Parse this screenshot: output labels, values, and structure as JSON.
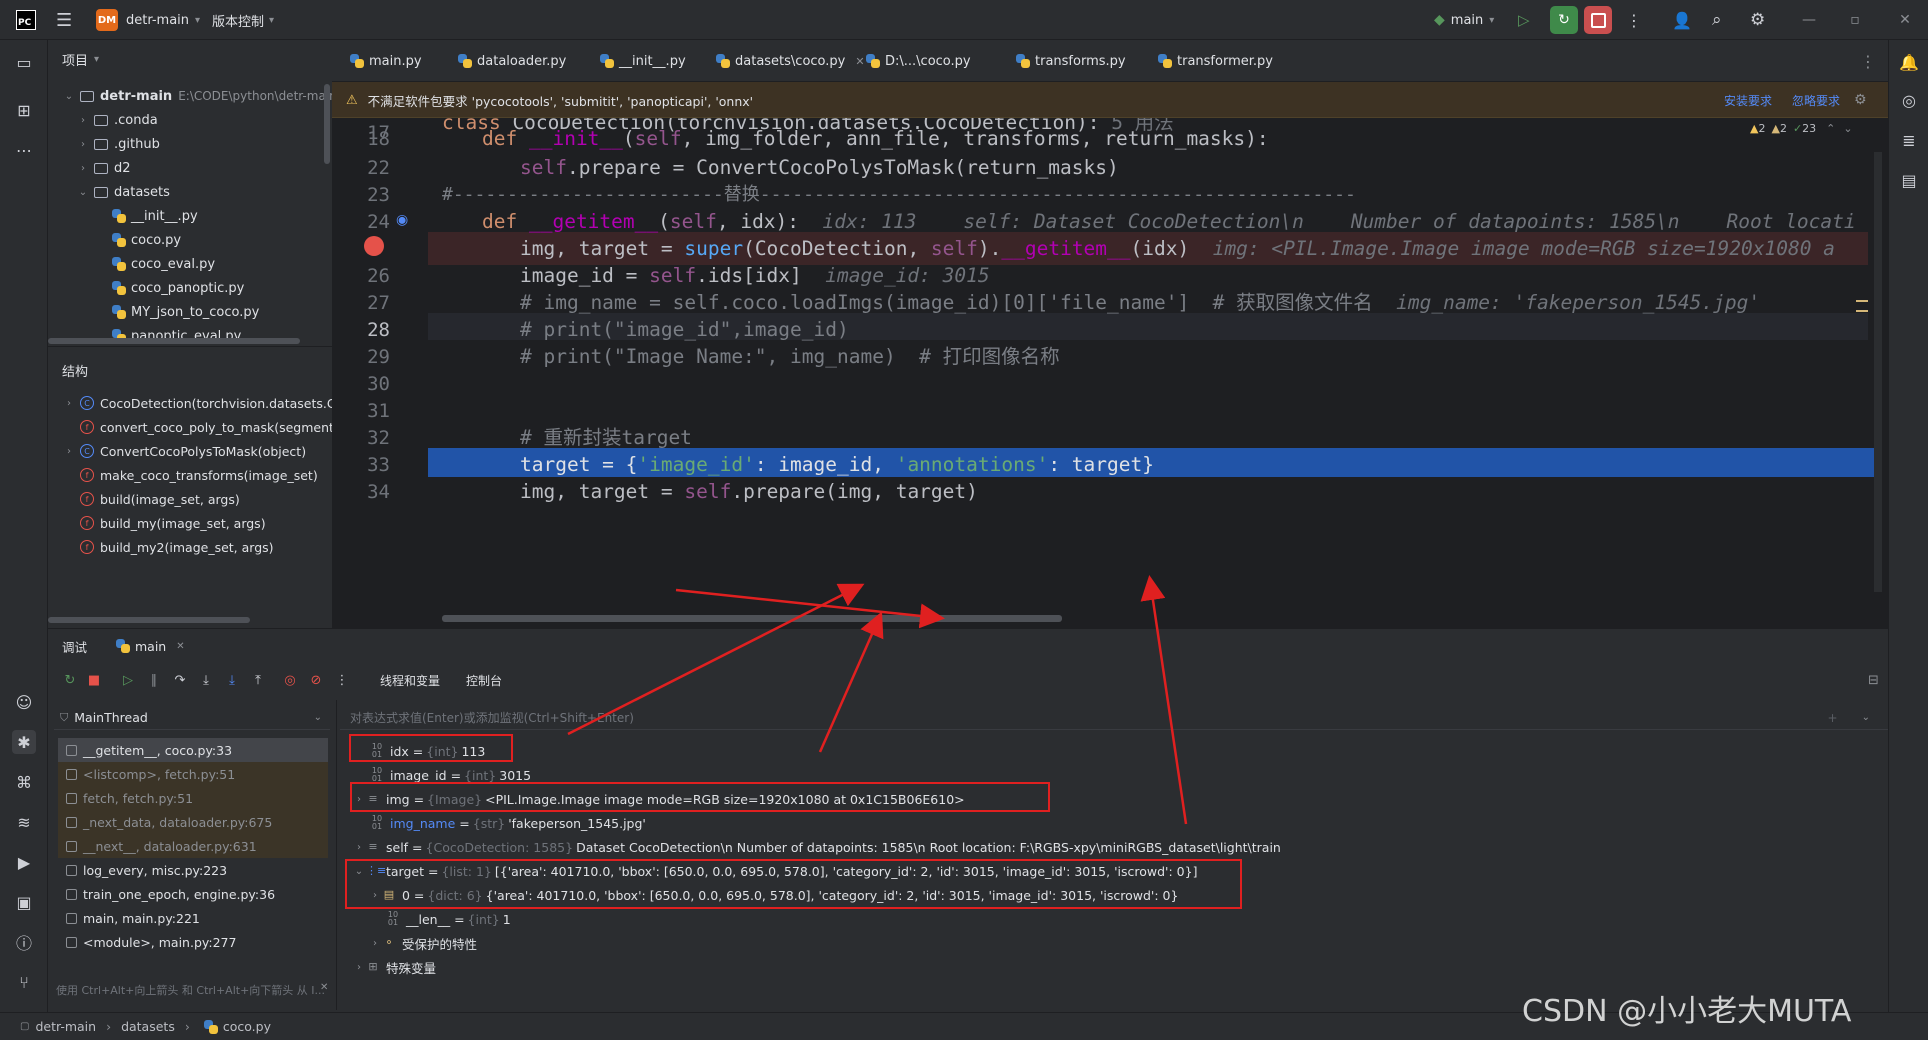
{
  "topbar": {
    "project_badge": "DM",
    "project_name": "detr-main",
    "vcs_label": "版本控制",
    "branch": "main"
  },
  "project_panel": {
    "title": "项目",
    "root_name": "detr-main",
    "root_path": "E:\\CODE\\python\\detr-main",
    "items": [
      ".conda",
      ".github",
      "d2",
      "datasets",
      "__init__.py",
      "coco.py",
      "coco_eval.py",
      "coco_panoptic.py",
      "MY_json_to_coco.py",
      "panoptic_eval.py"
    ]
  },
  "structure_panel": {
    "title": "结构",
    "items": [
      "CocoDetection(torchvision.datasets.Coco",
      "convert_coco_poly_to_mask(segmentatic",
      "ConvertCocoPolysToMask(object)",
      "make_coco_transforms(image_set)",
      "build(image_set, args)",
      "build_my(image_set, args)",
      "build_my2(image_set, args)"
    ]
  },
  "tabs": [
    "main.py",
    "dataloader.py",
    "__init__.py",
    "datasets\\coco.py",
    "D:\\...\\coco.py",
    "transforms.py",
    "transformer.py"
  ],
  "banner": {
    "message": "不满足软件包要求 'pycocotools', 'submitit', 'panopticapi', 'onnx'",
    "install": "安装要求",
    "ignore": "忽略要求"
  },
  "inspections": {
    "warn": "2",
    "weak": "2",
    "ok": "23"
  },
  "editor": {
    "line_numbers": [
      "17",
      "18",
      "22",
      "23",
      "24",
      "25",
      "26",
      "27",
      "28",
      "29",
      "30",
      "31",
      "32",
      "33",
      "34"
    ],
    "l17_usages": "5 用法",
    "l23_text": "#-------------------------替换-------------------------------------------------------",
    "l24_hint": "idx: 113    self: Dataset CocoDetection\\n    Number of datapoints: 1585\\n    Root locati",
    "l25_hint": "img: <PIL.Image.Image image mode=RGB size=1920x1080 a",
    "l26_hint": "image_id: 3015",
    "l27_comment": "# img_name = self.coco.loadImgs(image_id)[0]['file_name']  # 获取图像文件名",
    "l27_hint": "img_name: 'fakeperson_1545.jpg'",
    "l28_comment": "# print(\"image_id\",image_id)",
    "l29_comment": "# print(\"Image Name:\", img_name)  # 打印图像名称",
    "l32_comment": "# 重新封装target"
  },
  "debug": {
    "tab_debug": "调试",
    "tab_main": "main",
    "tab_threads": "线程和变量",
    "tab_console": "控制台",
    "thread": "MainThread",
    "eval_placeholder": "对表达式求值(Enter)或添加监视(Ctrl+Shift+Enter)",
    "frames": [
      "__getitem__, coco.py:33",
      "<listcomp>, fetch.py:51",
      "fetch, fetch.py:51",
      "_next_data, dataloader.py:675",
      "__next__, dataloader.py:631",
      "log_every, misc.py:223",
      "train_one_epoch, engine.py:36",
      "main, main.py:221",
      "<module>, main.py:277"
    ],
    "hint_bottom": "使用 Ctrl+Alt+向上箭头 和 Ctrl+Alt+向下箭头 从 I...",
    "vars": [
      {
        "name": "idx",
        "type": "{int}",
        "value": "113"
      },
      {
        "name": "image_id",
        "type": "{int}",
        "value": "3015"
      },
      {
        "name": "img",
        "type": "{Image}",
        "value": "<PIL.Image.Image image mode=RGB size=1920x1080 at 0x1C15B06E610>"
      },
      {
        "name": "img_name",
        "type": "{str}",
        "value": "'fakeperson_1545.jpg'"
      },
      {
        "name": "self",
        "type": "{CocoDetection: 1585}",
        "value": "Dataset CocoDetection\\n    Number of datapoints: 1585\\n    Root location: F:\\RGBS-xpy\\miniRGBS_dataset\\light\\train"
      },
      {
        "name": "target",
        "type": "{list: 1}",
        "value": "[{'area': 401710.0, 'bbox': [650.0, 0.0, 695.0, 578.0], 'category_id': 2, 'id': 3015, 'image_id': 3015, 'iscrowd': 0}]"
      },
      {
        "name": "0",
        "type": "{dict: 6}",
        "value": "{'area': 401710.0, 'bbox': [650.0, 0.0, 695.0, 578.0], 'category_id': 2, 'id': 3015, 'image_id': 3015, 'iscrowd': 0}"
      },
      {
        "name": "__len__",
        "type": "{int}",
        "value": "1"
      },
      {
        "name": "受保护的特性",
        "type": "",
        "value": ""
      },
      {
        "name": "特殊变量",
        "type": "",
        "value": ""
      }
    ]
  },
  "statusbar": {
    "crumbs": [
      "detr-main",
      "datasets",
      "coco.py"
    ],
    "watermark": "CSDN @小小老大MUTA"
  }
}
